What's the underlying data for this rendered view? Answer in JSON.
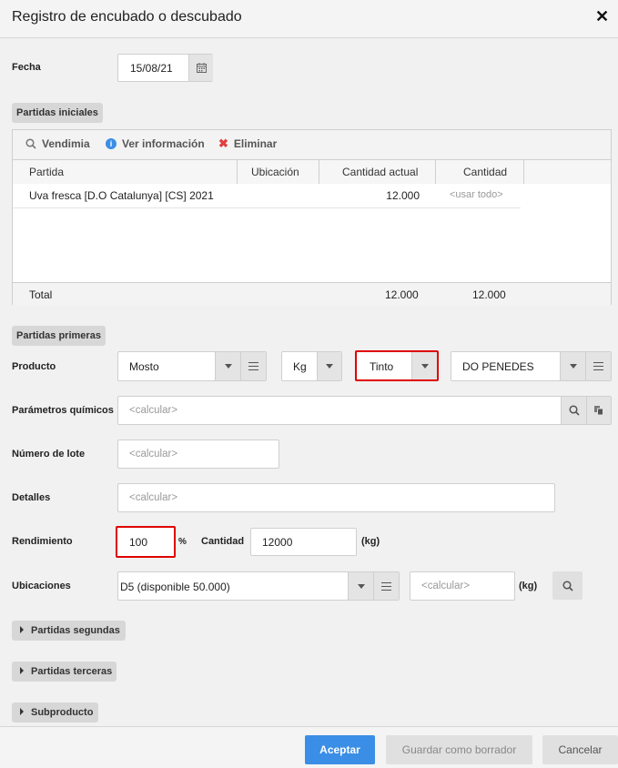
{
  "dialog": {
    "title": "Registro de encubado o descubado"
  },
  "fecha": {
    "label": "Fecha",
    "value": "15/08/21"
  },
  "partidas_iniciales": {
    "section_label": "Partidas iniciales",
    "toolbar": {
      "vendimia": "Vendimia",
      "ver_informacion": "Ver información",
      "eliminar": "Eliminar"
    },
    "columns": [
      "Partida",
      "Ubicación",
      "Cantidad actual",
      "Cantidad"
    ],
    "rows": [
      {
        "partida": "Uva fresca [D.O Catalunya] [CS] 2021",
        "ubicacion": "",
        "cantidad_actual": "12.000",
        "cantidad_placeholder": "<usar todo>"
      }
    ],
    "total": {
      "label": "Total",
      "cantidad_actual": "12.000",
      "cantidad": "12.000"
    }
  },
  "partidas_primeras": {
    "section_label": "Partidas primeras",
    "producto": {
      "label": "Producto",
      "product": "Mosto",
      "unit": "Kg",
      "color": "Tinto",
      "do": "DO PENEDES"
    },
    "parametros": {
      "label": "Parámetros químicos",
      "placeholder": "<calcular>"
    },
    "numero_lote": {
      "label": "Número de lote",
      "placeholder": "<calcular>"
    },
    "detalles": {
      "label": "Detalles",
      "placeholder": "<calcular>"
    },
    "rendimiento": {
      "label": "Rendimiento",
      "value": "100",
      "unit": "%"
    },
    "cantidad": {
      "label": "Cantidad",
      "value": "12000",
      "unit": "(kg)"
    },
    "ubicaciones": {
      "label": "Ubicaciones",
      "value": "D5 (disponible 50.000)",
      "placeholder": "<calcular>",
      "unit": "(kg)"
    }
  },
  "collapsed_sections": {
    "segundas": "Partidas segundas",
    "terceras": "Partidas terceras",
    "subproducto": "Subproducto"
  },
  "footer": {
    "aceptar": "Aceptar",
    "guardar_borrador": "Guardar como borrador",
    "cancelar": "Cancelar"
  },
  "colors": {
    "primary": "#3a8ee6",
    "highlight": "#e00000",
    "info": "#3a8ee6",
    "danger": "#e04040"
  }
}
